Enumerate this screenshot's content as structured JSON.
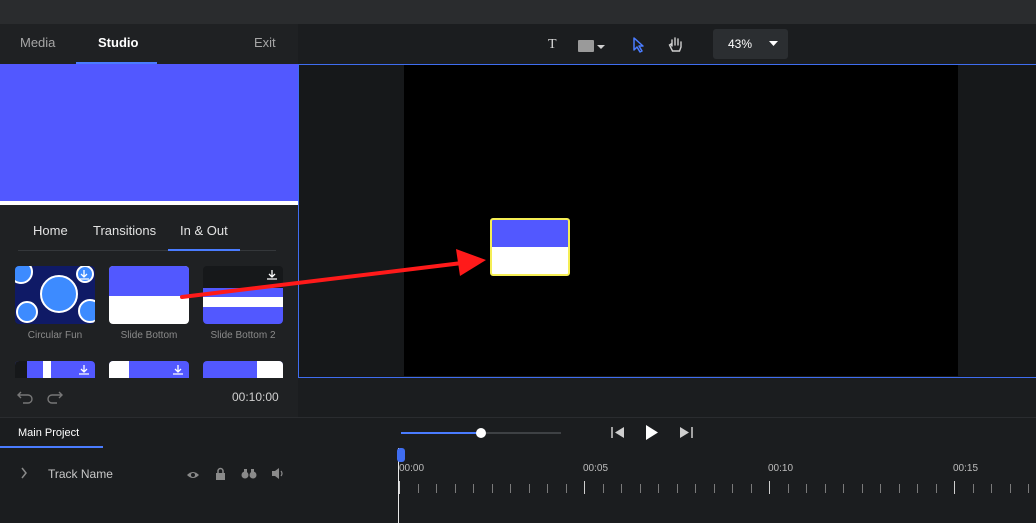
{
  "panel_tabs": {
    "media": "Media",
    "studio": "Studio",
    "exit": "Exit"
  },
  "sub_tabs": [
    "Home",
    "Transitions",
    "In & Out"
  ],
  "presets": [
    {
      "label": "Circular Fun"
    },
    {
      "label": "Slide Bottom"
    },
    {
      "label": "Slide Bottom 2"
    }
  ],
  "left_footer": {
    "time": "00:10:00"
  },
  "toolbar": {
    "zoom": "43%"
  },
  "timeline": {
    "project_tab": "Main Project",
    "track_name": "Track Name",
    "markers": [
      "00:00",
      "00:05",
      "00:10",
      "00:15"
    ],
    "playback_progress": 0.5
  },
  "colors": {
    "accent": "#4a7cff",
    "preset_blue": "#5258ff",
    "selection": "#f5ee55",
    "arrow": "#ff1a1a"
  }
}
